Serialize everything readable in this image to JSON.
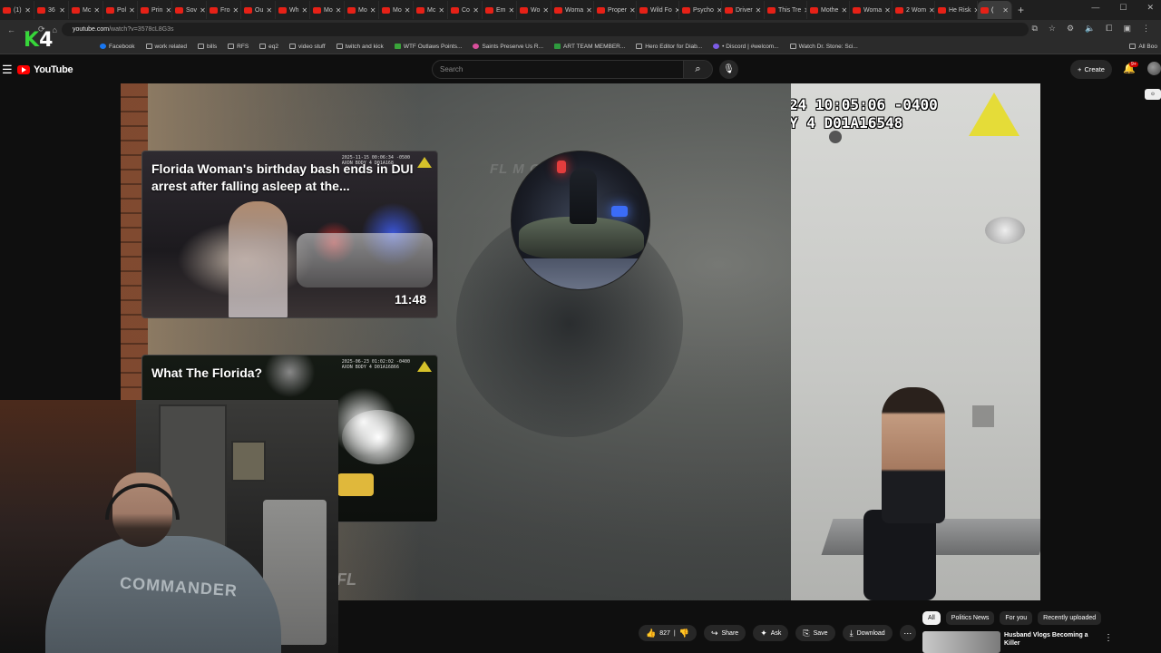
{
  "browser": {
    "tabs": [
      {
        "label": "(1)"
      },
      {
        "label": "36"
      },
      {
        "label": "Mc"
      },
      {
        "label": "Pol"
      },
      {
        "label": "Prin"
      },
      {
        "label": "Sov"
      },
      {
        "label": "Fro"
      },
      {
        "label": "Ou"
      },
      {
        "label": "Wh"
      },
      {
        "label": "Mo"
      },
      {
        "label": "Mo"
      },
      {
        "label": "Mo"
      },
      {
        "label": "Mc"
      },
      {
        "label": "Co"
      },
      {
        "label": "Em"
      },
      {
        "label": "Wo"
      },
      {
        "label": "Woma"
      },
      {
        "label": "Proper"
      },
      {
        "label": "Wild Fo"
      },
      {
        "label": "Psycho"
      },
      {
        "label": "Driver"
      },
      {
        "label": "This Tre"
      },
      {
        "label": "Mothe"
      },
      {
        "label": "Woma"
      },
      {
        "label": "2 Wom"
      },
      {
        "label": "He Risk"
      },
      {
        "label": "("
      }
    ],
    "active_tab_index": 26,
    "url_host": "youtube.com",
    "url_path": "/watch?v=3578cL8G3s",
    "bookmarks": [
      {
        "label": "Facebook",
        "icon": "facebook-icon"
      },
      {
        "label": "work related",
        "icon": "folder-icon"
      },
      {
        "label": "bills",
        "icon": "folder-icon"
      },
      {
        "label": "RFS",
        "icon": "folder-icon"
      },
      {
        "label": "eq2",
        "icon": "folder-icon"
      },
      {
        "label": "video stuff",
        "icon": "folder-icon"
      },
      {
        "label": "twitch and kick",
        "icon": "folder-icon"
      },
      {
        "label": "WTF Outlaws Points...",
        "icon": "wtf-icon"
      },
      {
        "label": "Saints Preserve Us R...",
        "icon": "saints-icon"
      },
      {
        "label": "ART TEAM MEMBER...",
        "icon": "art-icon"
      },
      {
        "label": "Hero Editor for Diab...",
        "icon": "github-icon"
      },
      {
        "label": "• Discord | #welcom...",
        "icon": "discord-icon"
      },
      {
        "label": "Watch Dr. Stone: Sci...",
        "icon": "globe-icon"
      }
    ],
    "all_bookmarks_label": "All Boo"
  },
  "overlay": {
    "k": "K",
    "four": "4"
  },
  "youtube": {
    "logo_text": "YouTube",
    "search_placeholder": "Search",
    "create_label": "Create",
    "notification_count": "9+"
  },
  "player": {
    "watermark": "FL M      CAM",
    "fl_mark": "FL",
    "cards": [
      {
        "title": "Florida Woman's birthday bash ends in DUI arrest after falling asleep at the...",
        "duration": "11:48",
        "stamp": "2025-11-15 00:06:34 -0500\nAXON BODY 4 D01A168"
      },
      {
        "title": "What The Florida?",
        "stamp": "2025-06-23 01:02:02 -0400\nAXON BODY 4 D01A16866"
      }
    ],
    "bodycam_stamp_line1": "24 10:05:06 -0400",
    "bodycam_stamp_line2": "Y 4  D01A16548",
    "webcam_shirt_text": "COMMANDER"
  },
  "actions": {
    "like_count": "827",
    "share_label": "Share",
    "ask_label": "Ask",
    "save_label": "Save",
    "download_label": "Download"
  },
  "chips": [
    {
      "label": "All",
      "active": true
    },
    {
      "label": "Politics News",
      "active": false
    },
    {
      "label": "For you",
      "active": false
    },
    {
      "label": "Recently uploaded",
      "active": false
    }
  ],
  "up_next": {
    "title": "Husband Vlogs Becoming a Killer"
  }
}
